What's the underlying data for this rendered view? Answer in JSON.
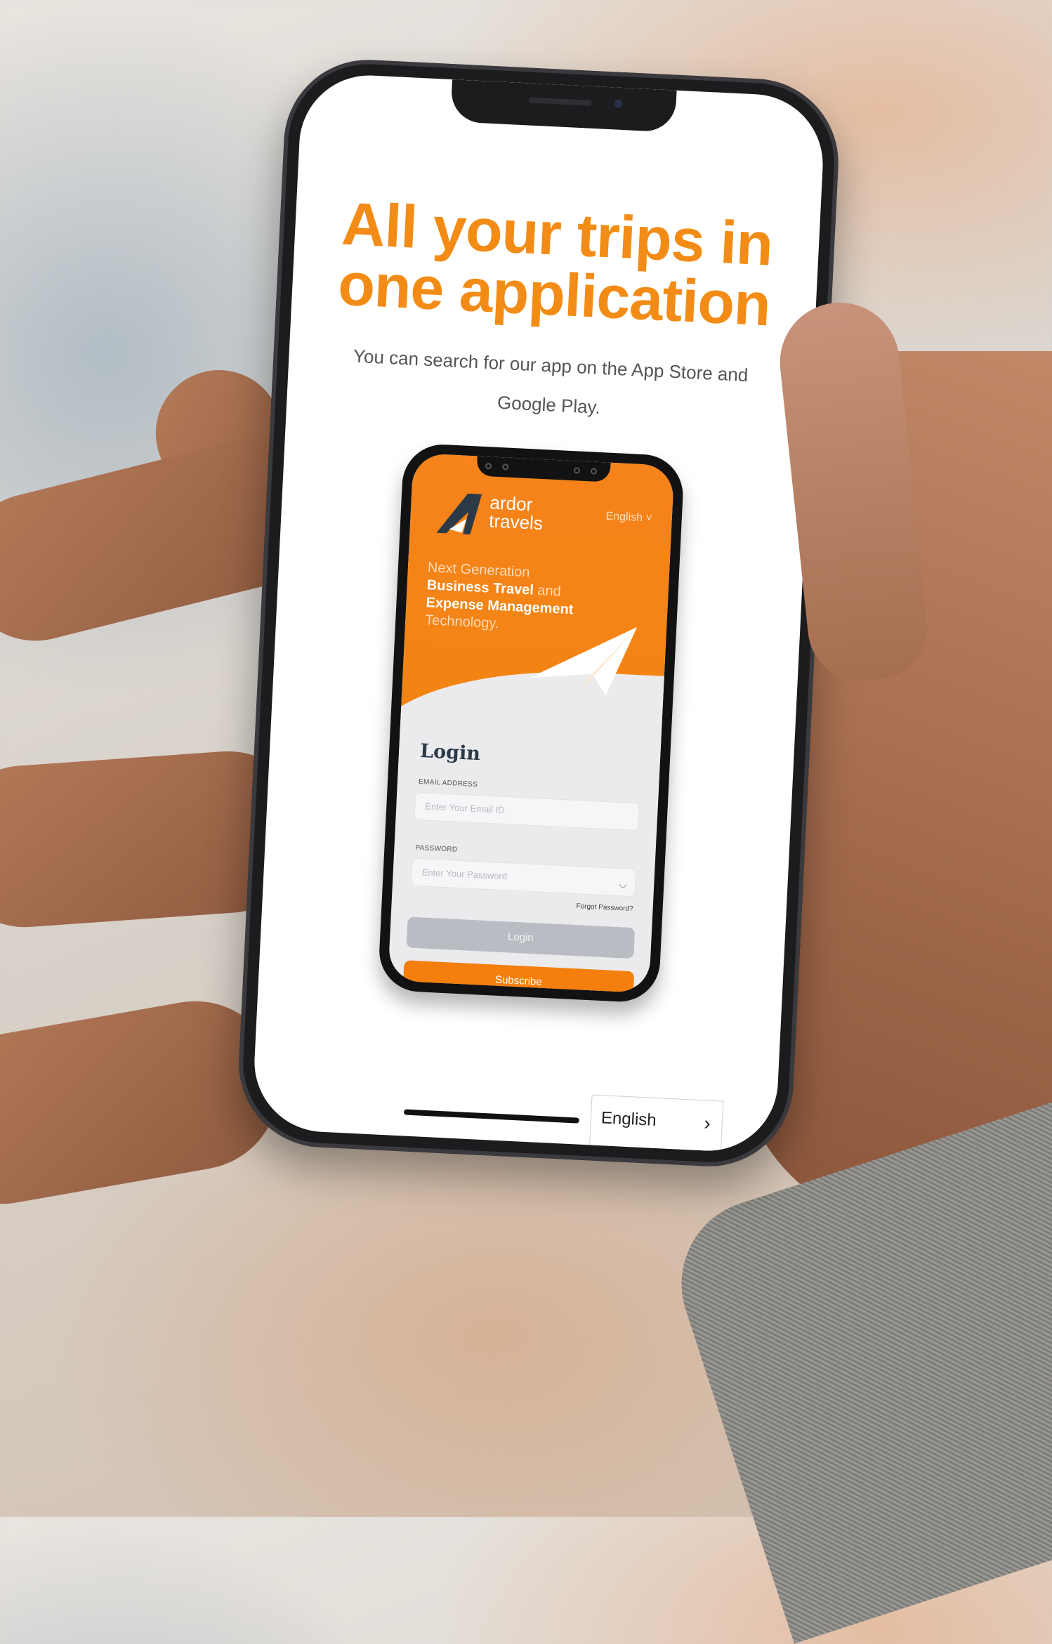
{
  "headline": {
    "line1": "All your trips in",
    "line2": "one application"
  },
  "subtext": {
    "line1": "You can search for our app on the App Store and",
    "line2": "Google Play."
  },
  "preview_app": {
    "brand": {
      "line1": "ardor",
      "line2": "travels"
    },
    "language": "English ˅",
    "tagline": {
      "part1": "Next Generation",
      "part2": "Business Travel",
      "part3": "and",
      "part4": "Expense Management",
      "part5": "Technology."
    },
    "login_title": "Login",
    "email_label": "EMAIL ADDRESS",
    "email_placeholder": "Enter Your Email ID",
    "password_label": "PASSWORD",
    "password_placeholder": "Enter Your Password",
    "eye_icon": "eye-icon",
    "forgot_password": "Forgot Password?",
    "login_button": "Login",
    "subscribe_button": "Subscribe",
    "colors": {
      "primary": "#f47f0d",
      "navy": "#2c3a48",
      "disabled": "#b9bdc3"
    }
  },
  "language_selector": {
    "label": "English",
    "icon": "chevron-right-icon",
    "glyph": "›"
  },
  "colors": {
    "headline": "#f28c16",
    "text": "#555555"
  }
}
